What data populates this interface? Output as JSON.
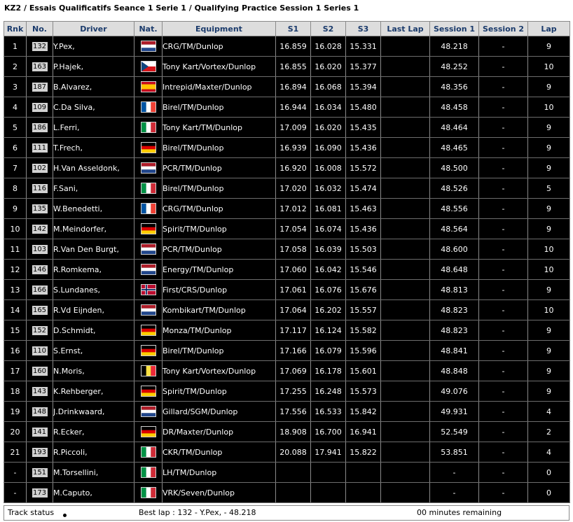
{
  "page_title": "KZ2 / Essais Qualificatifs Seance 1 Serie 1 / Qualifying Practice Session 1 Series 1",
  "columns": [
    "Rnk",
    "No.",
    "Driver",
    "Nat.",
    "Equipment",
    "S1",
    "S2",
    "S3",
    "Last Lap",
    "Session 1",
    "Session 2",
    "Lap"
  ],
  "rows": [
    {
      "rnk": "1",
      "no": "132",
      "driver": "Y.Pex,",
      "nat": "NL",
      "equipment": "CRG/TM/Dunlop",
      "s1": "16.859",
      "s2": "16.028",
      "s3": "15.331",
      "last_lap": "",
      "session1": "48.218",
      "session2": "-",
      "lap": "9"
    },
    {
      "rnk": "2",
      "no": "163",
      "driver": "P.Hajek,",
      "nat": "CZ",
      "equipment": "Tony Kart/Vortex/Dunlop",
      "s1": "16.855",
      "s2": "16.020",
      "s3": "15.377",
      "last_lap": "",
      "session1": "48.252",
      "session2": "-",
      "lap": "10"
    },
    {
      "rnk": "3",
      "no": "187",
      "driver": "B.Alvarez,",
      "nat": "ES",
      "equipment": "Intrepid/Maxter/Dunlop",
      "s1": "16.894",
      "s2": "16.068",
      "s3": "15.394",
      "last_lap": "",
      "session1": "48.356",
      "session2": "-",
      "lap": "9"
    },
    {
      "rnk": "4",
      "no": "109",
      "driver": "C.Da Silva,",
      "nat": "FR",
      "equipment": "Birel/TM/Dunlop",
      "s1": "16.944",
      "s2": "16.034",
      "s3": "15.480",
      "last_lap": "",
      "session1": "48.458",
      "session2": "-",
      "lap": "10"
    },
    {
      "rnk": "5",
      "no": "186",
      "driver": "L.Ferri,",
      "nat": "IT",
      "equipment": "Tony Kart/TM/Dunlop",
      "s1": "17.009",
      "s2": "16.020",
      "s3": "15.435",
      "last_lap": "",
      "session1": "48.464",
      "session2": "-",
      "lap": "9"
    },
    {
      "rnk": "6",
      "no": "111",
      "driver": "T.Frech,",
      "nat": "DE",
      "equipment": "Birel/TM/Dunlop",
      "s1": "16.939",
      "s2": "16.090",
      "s3": "15.436",
      "last_lap": "",
      "session1": "48.465",
      "session2": "-",
      "lap": "9"
    },
    {
      "rnk": "7",
      "no": "102",
      "driver": "H.Van Asseldonk,",
      "nat": "NL",
      "equipment": "PCR/TM/Dunlop",
      "s1": "16.920",
      "s2": "16.008",
      "s3": "15.572",
      "last_lap": "",
      "session1": "48.500",
      "session2": "-",
      "lap": "9"
    },
    {
      "rnk": "8",
      "no": "116",
      "driver": "F.Sani,",
      "nat": "IT",
      "equipment": "Birel/TM/Dunlop",
      "s1": "17.020",
      "s2": "16.032",
      "s3": "15.474",
      "last_lap": "",
      "session1": "48.526",
      "session2": "-",
      "lap": "5"
    },
    {
      "rnk": "9",
      "no": "135",
      "driver": "W.Benedetti,",
      "nat": "FR",
      "equipment": "CRG/TM/Dunlop",
      "s1": "17.012",
      "s2": "16.081",
      "s3": "15.463",
      "last_lap": "",
      "session1": "48.556",
      "session2": "-",
      "lap": "9"
    },
    {
      "rnk": "10",
      "no": "142",
      "driver": "M.Meindorfer,",
      "nat": "DE",
      "equipment": "Spirit/TM/Dunlop",
      "s1": "17.054",
      "s2": "16.074",
      "s3": "15.436",
      "last_lap": "",
      "session1": "48.564",
      "session2": "-",
      "lap": "9"
    },
    {
      "rnk": "11",
      "no": "103",
      "driver": "R.Van Den Burgt,",
      "nat": "NL",
      "equipment": "PCR/TM/Dunlop",
      "s1": "17.058",
      "s2": "16.039",
      "s3": "15.503",
      "last_lap": "",
      "session1": "48.600",
      "session2": "-",
      "lap": "10"
    },
    {
      "rnk": "12",
      "no": "146",
      "driver": "R.Romkema,",
      "nat": "NL",
      "equipment": "Energy/TM/Dunlop",
      "s1": "17.060",
      "s2": "16.042",
      "s3": "15.546",
      "last_lap": "",
      "session1": "48.648",
      "session2": "-",
      "lap": "10"
    },
    {
      "rnk": "13",
      "no": "166",
      "driver": "S.Lundanes,",
      "nat": "NO",
      "equipment": "First/CRS/Dunlop",
      "s1": "17.061",
      "s2": "16.076",
      "s3": "15.676",
      "last_lap": "",
      "session1": "48.813",
      "session2": "-",
      "lap": "9"
    },
    {
      "rnk": "14",
      "no": "165",
      "driver": "R.Vd Eijnden,",
      "nat": "NL",
      "equipment": "Kombikart/TM/Dunlop",
      "s1": "17.064",
      "s2": "16.202",
      "s3": "15.557",
      "last_lap": "",
      "session1": "48.823",
      "session2": "-",
      "lap": "10"
    },
    {
      "rnk": "15",
      "no": "152",
      "driver": "D.Schmidt,",
      "nat": "DE",
      "equipment": "Monza/TM/Dunlop",
      "s1": "17.117",
      "s2": "16.124",
      "s3": "15.582",
      "last_lap": "",
      "session1": "48.823",
      "session2": "-",
      "lap": "9"
    },
    {
      "rnk": "16",
      "no": "110",
      "driver": "S.Ernst,",
      "nat": "DE",
      "equipment": "Birel/TM/Dunlop",
      "s1": "17.166",
      "s2": "16.079",
      "s3": "15.596",
      "last_lap": "",
      "session1": "48.841",
      "session2": "-",
      "lap": "9"
    },
    {
      "rnk": "17",
      "no": "160",
      "driver": "N.Moris,",
      "nat": "BE",
      "equipment": "Tony Kart/Vortex/Dunlop",
      "s1": "17.069",
      "s2": "16.178",
      "s3": "15.601",
      "last_lap": "",
      "session1": "48.848",
      "session2": "-",
      "lap": "9"
    },
    {
      "rnk": "18",
      "no": "143",
      "driver": "K.Rehberger,",
      "nat": "DE",
      "equipment": "Spirit/TM/Dunlop",
      "s1": "17.255",
      "s2": "16.248",
      "s3": "15.573",
      "last_lap": "",
      "session1": "49.076",
      "session2": "-",
      "lap": "9"
    },
    {
      "rnk": "19",
      "no": "148",
      "driver": "J.Drinkwaard,",
      "nat": "NL",
      "equipment": "Gillard/SGM/Dunlop",
      "s1": "17.556",
      "s2": "16.533",
      "s3": "15.842",
      "last_lap": "",
      "session1": "49.931",
      "session2": "-",
      "lap": "4"
    },
    {
      "rnk": "20",
      "no": "141",
      "driver": "R.Ecker,",
      "nat": "DE",
      "equipment": "DR/Maxter/Dunlop",
      "s1": "18.908",
      "s2": "16.700",
      "s3": "16.941",
      "last_lap": "",
      "session1": "52.549",
      "session2": "-",
      "lap": "2"
    },
    {
      "rnk": "21",
      "no": "193",
      "driver": "R.Piccoli,",
      "nat": "IT",
      "equipment": "CKR/TM/Dunlop",
      "s1": "20.088",
      "s2": "17.941",
      "s3": "15.822",
      "last_lap": "",
      "session1": "53.851",
      "session2": "-",
      "lap": "4"
    },
    {
      "rnk": "-",
      "no": "151",
      "driver": "M.Torsellini,",
      "nat": "IT",
      "equipment": "LH/TM/Dunlop",
      "s1": "",
      "s2": "",
      "s3": "",
      "last_lap": "",
      "session1": "-",
      "session2": "-",
      "lap": "0"
    },
    {
      "rnk": "-",
      "no": "173",
      "driver": "M.Caputo,",
      "nat": "IT",
      "equipment": "VRK/Seven/Dunlop",
      "s1": "",
      "s2": "",
      "s3": "",
      "last_lap": "",
      "session1": "-",
      "session2": "-",
      "lap": "0"
    }
  ],
  "status_bar": {
    "track_status_label": "Track status",
    "best_lap": "Best lap : 132 - Y.Pex, - 48.218",
    "remaining": "00 minutes remaining"
  },
  "flags": {
    "NL": {
      "type": "h",
      "colors": [
        "#ae1c28",
        "#ffffff",
        "#21468b"
      ]
    },
    "FR": {
      "type": "v",
      "colors": [
        "#0055a4",
        "#ffffff",
        "#ef4135"
      ]
    },
    "IT": {
      "type": "v",
      "colors": [
        "#009246",
        "#ffffff",
        "#ce2b37"
      ]
    },
    "DE": {
      "type": "h",
      "colors": [
        "#000000",
        "#dd0000",
        "#ffce00"
      ]
    },
    "BE": {
      "type": "v",
      "colors": [
        "#000000",
        "#fae042",
        "#ed2939"
      ]
    },
    "ES": {
      "type": "es",
      "colors": [
        "#c60b1e",
        "#ffc400"
      ]
    },
    "CZ": {
      "type": "cz",
      "colors": [
        "#ffffff",
        "#d7141a",
        "#11457e"
      ]
    },
    "NO": {
      "type": "no",
      "colors": [
        "#ba0c2f",
        "#ffffff",
        "#00205b"
      ]
    }
  }
}
